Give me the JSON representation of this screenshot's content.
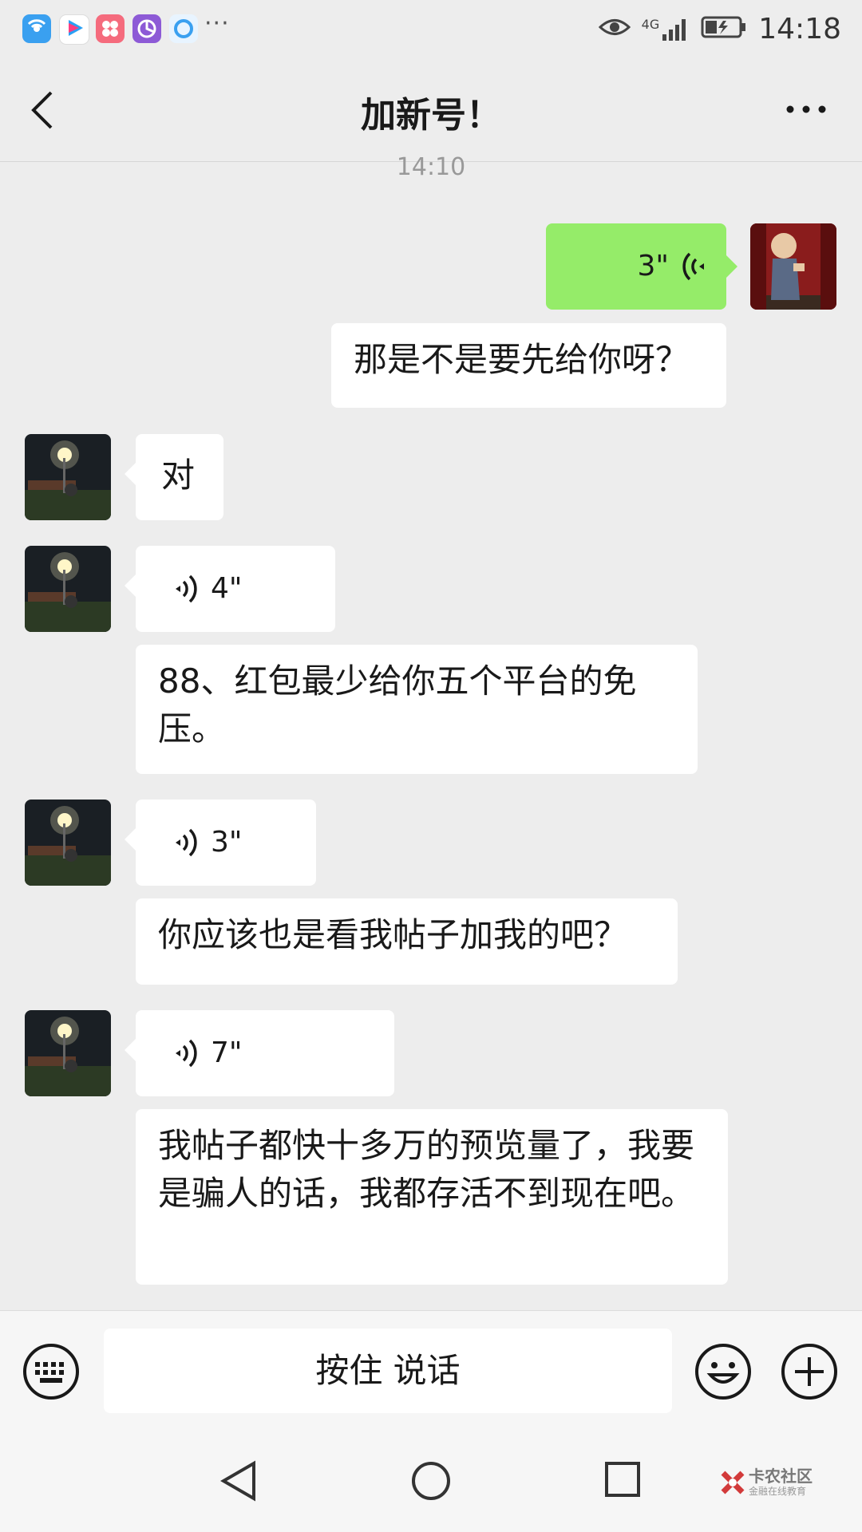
{
  "status_bar": {
    "more_apps": "···",
    "network": "4G",
    "time": "14:18",
    "app_icons": [
      "wifi-app-icon",
      "youku-icon",
      "app-icon-pink",
      "app-icon-purple",
      "app-icon-blue"
    ]
  },
  "header": {
    "title": "加新号！"
  },
  "chat": {
    "timestamp": "14:10",
    "messages": [
      {
        "side": "right",
        "type": "voice",
        "duration": "3\""
      },
      {
        "side": "right",
        "type": "text",
        "text": "那是不是要先给你呀？"
      },
      {
        "side": "left",
        "type": "text",
        "text": "对"
      },
      {
        "side": "left",
        "type": "voice",
        "duration": "4\""
      },
      {
        "side": "left",
        "type": "text",
        "text": "88、红包最少给你五个平台的免压。"
      },
      {
        "side": "left",
        "type": "voice",
        "duration": "3\""
      },
      {
        "side": "left",
        "type": "text",
        "text": "你应该也是看我帖子加我的吧？"
      },
      {
        "side": "left",
        "type": "voice",
        "duration": "7\""
      },
      {
        "side": "left",
        "type": "text",
        "text": "我帖子都快十多万的预览量了，我要是骗人的话，我都存活不到现在吧。"
      }
    ]
  },
  "input_bar": {
    "hold_to_talk": "按住 说话"
  },
  "watermark": {
    "brand": "卡农社区",
    "slogan": "金融在线教育"
  },
  "colors": {
    "background": "#ededed",
    "self_bubble": "#95ec69",
    "other_bubble": "#ffffff"
  }
}
